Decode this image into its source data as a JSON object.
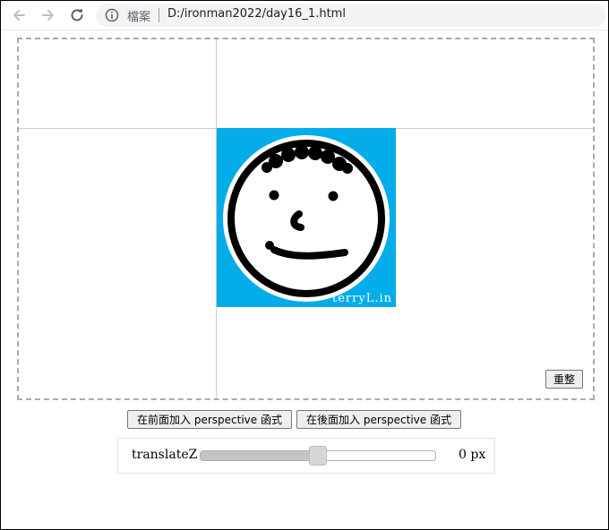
{
  "browser": {
    "scheme_label": "檔案",
    "url": "D:/ironman2022/day16_1.html",
    "icons": {
      "back": "arrow-left-icon",
      "forward": "arrow-right-icon",
      "reload": "reload-icon",
      "info": "info-icon"
    }
  },
  "stage": {
    "image_watermark": "terryL.in",
    "reset_label": "重整"
  },
  "controls": {
    "add_front_label": "在前面加入 perspective 函式",
    "add_back_label": "在後面加入 perspective 函式",
    "slider_label": "translateZ",
    "slider_value": "0",
    "slider_unit": "px",
    "slider_fraction": 0.5
  },
  "colors": {
    "image_background": "#04acea",
    "face": "#ffffff",
    "ink": "#000000"
  }
}
